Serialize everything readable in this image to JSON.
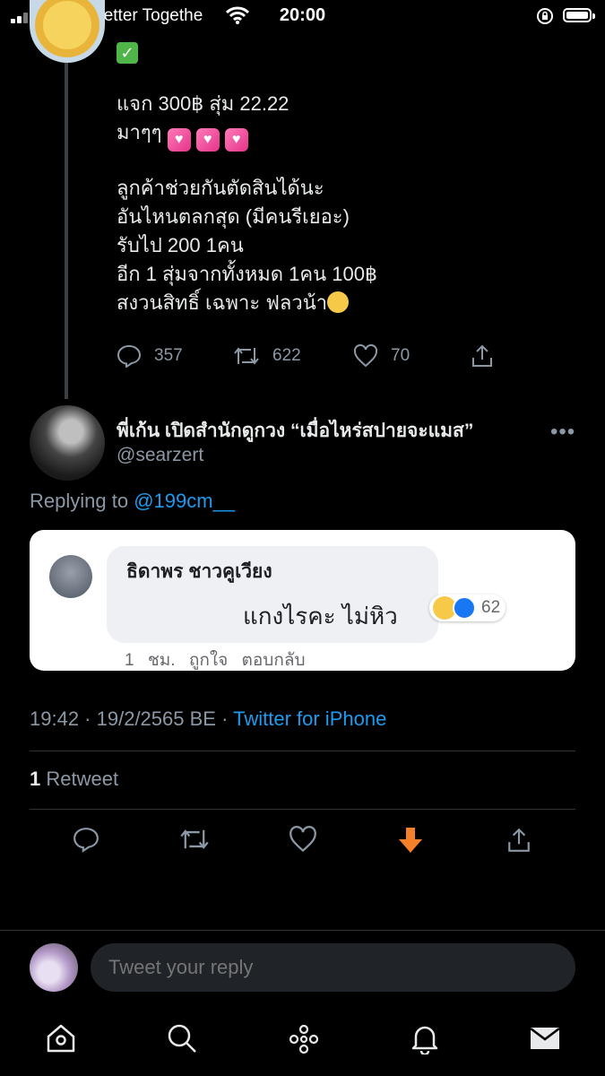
{
  "status_bar": {
    "carrier": "dtac-T.Better Togethe",
    "time": "20:00"
  },
  "parent_tweet": {
    "lines": [
      "แจก 300฿ สุ่ม 22.22",
      "มาๆๆ",
      "ลูกค้าช่วยกันตัดสินได้นะ",
      "อันไหนตลกสุด (มีคนรีเยอะ)",
      "รับไป  200 1คน",
      "อีก 1 สุ่มจากทั้งหมด 1คน 100฿",
      "สงวนสิทธิ์ เฉพาะ ฟลวน้า"
    ],
    "reply_count": "357",
    "retweet_count": "622",
    "like_count": "70"
  },
  "tweet": {
    "display_name": "พี่เก้น เปิดสำนักดูกวง “เมื่อไหร่สปายจะแมส”",
    "handle": "@searzert",
    "replying_prefix": "Replying to",
    "replying_to": "@199cm__",
    "image": {
      "commenter_name": "ธิดาพร ชาวคูเวียง",
      "comment_text": "แกงไรคะ ไม่หิว",
      "reaction_count": "62",
      "meta": "1 ชม.  ถูกใจ  ตอบกลับ"
    },
    "time": "19:42",
    "date": "19/2/2565 BE",
    "source": "Twitter for iPhone",
    "retweet_number": "1",
    "retweet_label": "Retweet"
  },
  "reply_bar": {
    "placeholder": "Tweet your reply"
  },
  "colors": {
    "accent_blue": "#1d9bf0",
    "download_orange": "#f4802a",
    "muted": "#8b98a5"
  }
}
